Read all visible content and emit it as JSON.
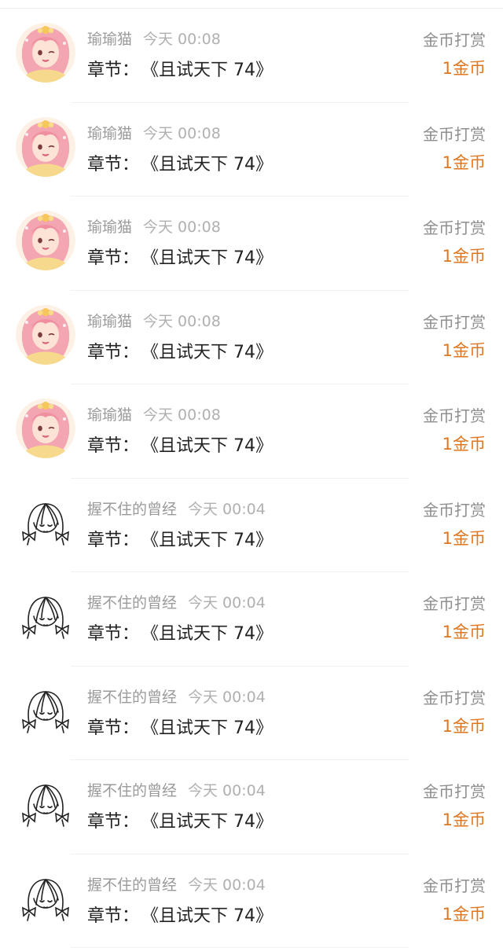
{
  "accent_color": "#e0761e",
  "tip_list": [
    {
      "avatar": "anime-girl-avatar",
      "username": "瑜瑜猫",
      "time": "今天 00:08",
      "chapter_label": "章节：",
      "chapter_title": "《且试天下 74》",
      "tip_type": "金币打赏",
      "amount": "1金币"
    },
    {
      "avatar": "anime-girl-avatar",
      "username": "瑜瑜猫",
      "time": "今天 00:08",
      "chapter_label": "章节：",
      "chapter_title": "《且试天下 74》",
      "tip_type": "金币打赏",
      "amount": "1金币"
    },
    {
      "avatar": "anime-girl-avatar",
      "username": "瑜瑜猫",
      "time": "今天 00:08",
      "chapter_label": "章节：",
      "chapter_title": "《且试天下 74》",
      "tip_type": "金币打赏",
      "amount": "1金币"
    },
    {
      "avatar": "anime-girl-avatar",
      "username": "瑜瑜猫",
      "time": "今天 00:08",
      "chapter_label": "章节：",
      "chapter_title": "《且试天下 74》",
      "tip_type": "金币打赏",
      "amount": "1金币"
    },
    {
      "avatar": "anime-girl-avatar",
      "username": "瑜瑜猫",
      "time": "今天 00:08",
      "chapter_label": "章节：",
      "chapter_title": "《且试天下 74》",
      "tip_type": "金币打赏",
      "amount": "1金币"
    },
    {
      "avatar": "line-drawing-girl-avatar",
      "username": "握不住的曾经",
      "time": "今天 00:04",
      "chapter_label": "章节：",
      "chapter_title": "《且试天下 74》",
      "tip_type": "金币打赏",
      "amount": "1金币"
    },
    {
      "avatar": "line-drawing-girl-avatar",
      "username": "握不住的曾经",
      "time": "今天 00:04",
      "chapter_label": "章节：",
      "chapter_title": "《且试天下 74》",
      "tip_type": "金币打赏",
      "amount": "1金币"
    },
    {
      "avatar": "line-drawing-girl-avatar",
      "username": "握不住的曾经",
      "time": "今天 00:04",
      "chapter_label": "章节：",
      "chapter_title": "《且试天下 74》",
      "tip_type": "金币打赏",
      "amount": "1金币"
    },
    {
      "avatar": "line-drawing-girl-avatar",
      "username": "握不住的曾经",
      "time": "今天 00:04",
      "chapter_label": "章节：",
      "chapter_title": "《且试天下 74》",
      "tip_type": "金币打赏",
      "amount": "1金币"
    },
    {
      "avatar": "line-drawing-girl-avatar",
      "username": "握不住的曾经",
      "time": "今天 00:04",
      "chapter_label": "章节：",
      "chapter_title": "《且试天下 74》",
      "tip_type": "金币打赏",
      "amount": "1金币"
    }
  ]
}
